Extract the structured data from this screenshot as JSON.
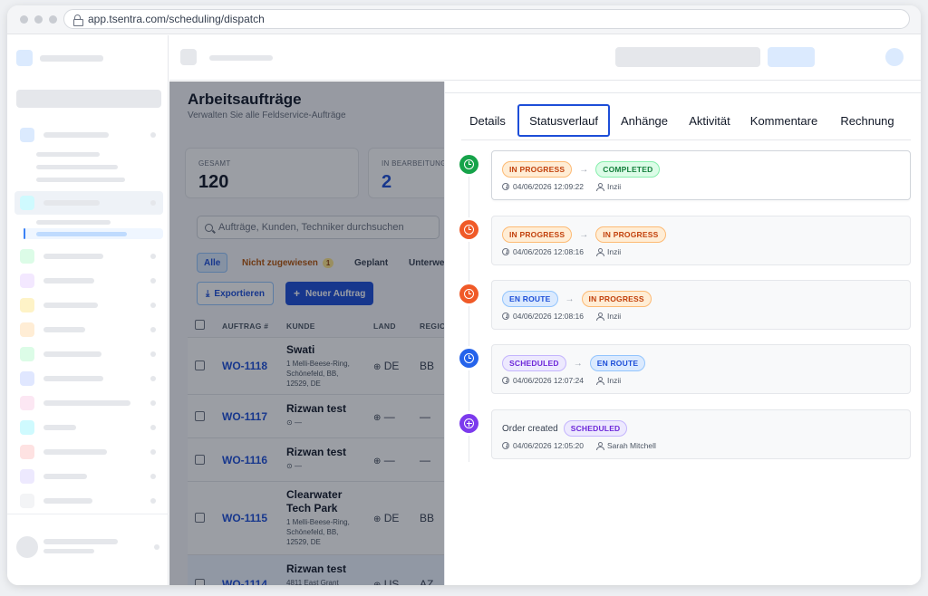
{
  "browser": {
    "url": "app.tsentra.com/scheduling/dispatch"
  },
  "page": {
    "title": "Arbeitsaufträge",
    "subtitle": "Verwalten Sie alle Feldservice-Aufträge"
  },
  "stats": [
    {
      "label": "GESAMT",
      "value": "120"
    },
    {
      "label": "IN BEARBEITUNG",
      "value": "2"
    }
  ],
  "search": {
    "placeholder": "Aufträge, Kunden, Techniker durchsuchen"
  },
  "filters": [
    {
      "label": "Alle"
    },
    {
      "label": "Nicht zugewiesen",
      "count": "1"
    },
    {
      "label": "Geplant"
    },
    {
      "label": "Unterwe"
    }
  ],
  "actions": {
    "export_label": "Exportieren",
    "new_label": "Neuer Auftrag",
    "export_icon": "download-icon",
    "new_icon": "plus-icon"
  },
  "table": {
    "columns": [
      "AUFTRAG #",
      "KUNDE",
      "LAND",
      "REGIO"
    ],
    "rows": [
      {
        "id": "WO-1118",
        "customer": "Swati",
        "address": "1 Melli-Beese-Ring, Schönefeld, BB, 12529, DE",
        "country": "DE",
        "region": "BB"
      },
      {
        "id": "WO-1117",
        "customer": "Rizwan test",
        "address": "—",
        "country": "—",
        "region": "—"
      },
      {
        "id": "WO-1116",
        "customer": "Rizwan test",
        "address": "—",
        "country": "—",
        "region": "—"
      },
      {
        "id": "WO-1115",
        "customer": "Clearwater Tech Park",
        "address": "1 Melli-Beese-Ring, Schönefeld, BB, 12529, DE",
        "country": "DE",
        "region": "BB"
      },
      {
        "id": "WO-1114",
        "customer": "Rizwan test",
        "address": "4811 East Grant",
        "country": "US",
        "region": "AZ"
      }
    ]
  },
  "panel": {
    "tabs": [
      {
        "label": "Details"
      },
      {
        "label": "Statusverlauf"
      },
      {
        "label": "Anhänge"
      },
      {
        "label": "Aktivität"
      },
      {
        "label": "Kommentare"
      },
      {
        "label": "Rechnung"
      }
    ],
    "selected_tab": "Statusverlauf",
    "timeline": [
      {
        "icon": "clock-icon",
        "color": "#16a34a",
        "from": "IN PROGRESS",
        "to": "COMPLETED",
        "time": "04/06/2026 12:09:22",
        "user": "Inzii"
      },
      {
        "icon": "clock-icon",
        "color": "#f05a28",
        "from": "IN PROGRESS",
        "to": "IN PROGRESS",
        "time": "04/06/2026 12:08:16",
        "user": "Inzii"
      },
      {
        "icon": "clock-icon",
        "color": "#f05a28",
        "from": "EN ROUTE",
        "to": "IN PROGRESS",
        "time": "04/06/2026 12:08:16",
        "user": "Inzii"
      },
      {
        "icon": "clock-icon",
        "color": "#2563eb",
        "from": "SCHEDULED",
        "to": "EN ROUTE",
        "time": "04/06/2026 12:07:24",
        "user": "Inzii"
      },
      {
        "icon": "plus-circle-icon",
        "color": "#7c3aed",
        "text": "Order created",
        "to": "SCHEDULED",
        "time": "04/06/2026 12:05:20",
        "user": "Sarah Mitchell"
      }
    ]
  },
  "status_colors": {
    "IN PROGRESS": {
      "bg": "#ffedd5",
      "border": "#fdba74",
      "fg": "#c2410c"
    },
    "COMPLETED": {
      "bg": "#dcfce7",
      "border": "#86efac",
      "fg": "#15803d"
    },
    "EN ROUTE": {
      "bg": "#dbeafe",
      "border": "#93c5fd",
      "fg": "#1d4ed8"
    },
    "SCHEDULED": {
      "bg": "#ede9fe",
      "border": "#c4b5fd",
      "fg": "#6d28d9"
    }
  }
}
